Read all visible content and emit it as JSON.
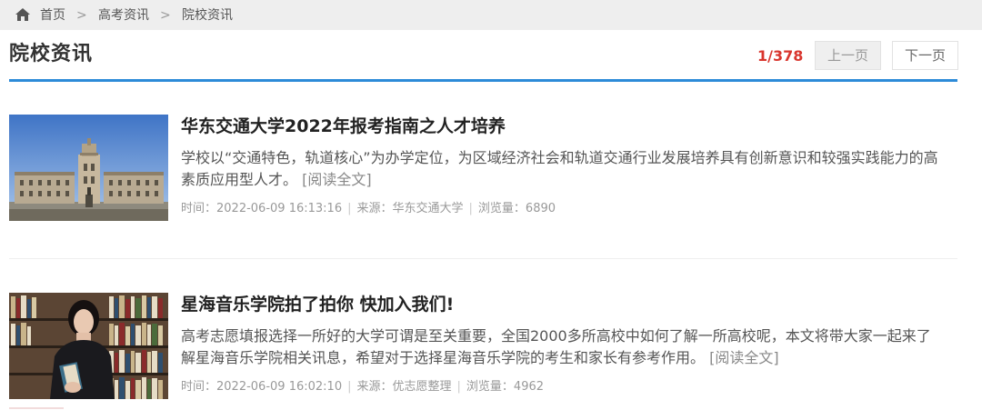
{
  "breadcrumb": {
    "items": [
      "首页",
      "高考资讯",
      "院校资讯"
    ],
    "separator": ">"
  },
  "page": {
    "title": "院校资讯"
  },
  "pager": {
    "count": "1/378",
    "prev_label": "上一页",
    "next_label": "下一页"
  },
  "articles": [
    {
      "title": "华东交通大学2022年报考指南之人才培养",
      "summary": "学校以“交通特色，轨道核心”为办学定位，为区域经济社会和轨道交通行业发展培养具有创新意识和较强实践能力的高素质应用型人才。",
      "read_more": "[阅读全文]",
      "time_label": "时间：",
      "time": "2022-06-09 16:13:16",
      "source_label": "来源：",
      "source": "华东交通大学",
      "views_label": "浏览量：",
      "views": "6890",
      "thumb_icon": "university-building-photo"
    },
    {
      "title": "星海音乐学院拍了拍你 快加入我们!",
      "summary": "高考志愿填报选择一所好的大学可谓是至关重要，全国2000多所高校中如何了解一所高校呢，本文将带大家一起来了解星海音乐学院相关讯息，希望对于选择星海音乐学院的考生和家长有参考作用。",
      "read_more": "[阅读全文]",
      "time_label": "时间：",
      "time": "2022-06-09 16:02:10",
      "source_label": "来源：",
      "source": "优志愿整理",
      "views_label": "浏览量：",
      "views": "4962",
      "thumb_icon": "student-library-photo"
    }
  ],
  "colors": {
    "accent_blue": "#2d8bd8",
    "pager_red": "#d9362e"
  }
}
